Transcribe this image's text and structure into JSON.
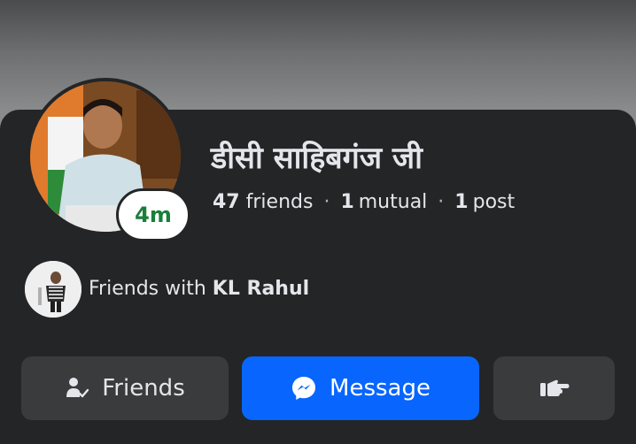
{
  "profile": {
    "name": "डीसी साहिबगंज जी",
    "active_badge": "4m",
    "stats": {
      "friends_count": "47",
      "friends_label": "friends",
      "mutual_count": "1",
      "mutual_label": "mutual",
      "posts_count": "1",
      "posts_label": "post",
      "separator": "·"
    }
  },
  "mutual": {
    "prefix": "Friends with ",
    "name": "KL Rahul"
  },
  "actions": {
    "friends_label": "Friends",
    "message_label": "Message",
    "more_icon": "hand-pointing-icon"
  },
  "colors": {
    "card_bg": "#242526",
    "button_bg": "#3a3b3c",
    "primary": "#0866ff",
    "active_green": "#1a7f3a"
  }
}
